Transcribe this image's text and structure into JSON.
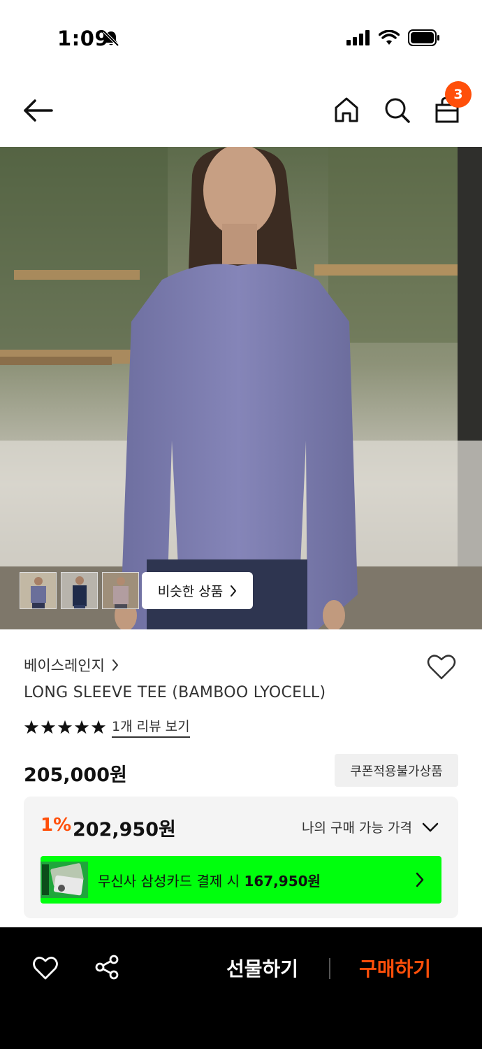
{
  "status": {
    "time": "1:09"
  },
  "nav": {
    "cart_count": "3"
  },
  "hero": {
    "similar_label": "비슷한 상품"
  },
  "product": {
    "brand": "베이스레인지",
    "title": "LONG SLEEVE TEE (BAMBOO LYOCELL)",
    "rating_stars": 5,
    "review_link": "1개 리뷰 보기",
    "price": "205,000원",
    "coupon_badge": "쿠폰적용불가상품"
  },
  "price_box": {
    "discount_pct": "1%",
    "discount_price": "202,950원",
    "my_price_label": "나의 구매 가능 가격",
    "card_text_prefix": "무신사 삼성카드 결제 시 ",
    "card_price": "167,950원"
  },
  "bottom_bar": {
    "gift_label": "선물하기",
    "buy_label": "구매하기"
  },
  "colors": {
    "accent": "#ff4f0a",
    "card_banner": "#00ff0d",
    "bottom_bar": "#000000"
  },
  "icons": [
    "bell-slash-icon",
    "signal-icon",
    "wifi-icon",
    "battery-icon",
    "back-arrow-icon",
    "home-icon",
    "search-icon",
    "cart-icon",
    "chevron-right-icon",
    "heart-icon",
    "star-icon",
    "chevron-down-icon",
    "share-icon"
  ]
}
